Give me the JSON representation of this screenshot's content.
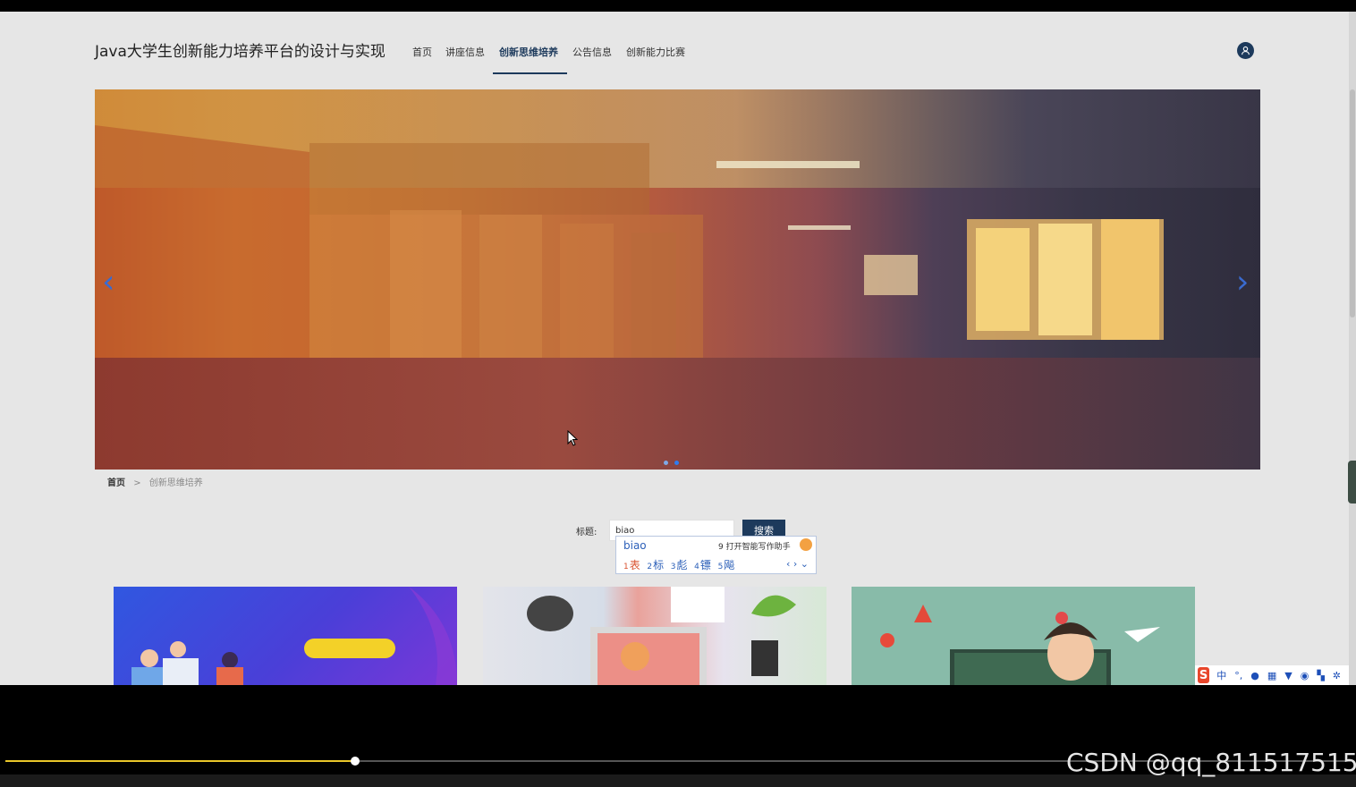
{
  "site": {
    "title": "Java大学生创新能力培养平台的设计与实现"
  },
  "nav": {
    "items": [
      {
        "label": "首页"
      },
      {
        "label": "讲座信息"
      },
      {
        "label": "创新思维培养",
        "active": true
      },
      {
        "label": "公告信息"
      },
      {
        "label": "创新能力比赛"
      }
    ]
  },
  "breadcrumb": {
    "home": "首页",
    "separator": ">",
    "current": "创新思维培养"
  },
  "search": {
    "label": "标题:",
    "value": "biao",
    "button": "搜索"
  },
  "ime": {
    "pinyin": "biao",
    "assist": "9 打开智能写作助手",
    "candidates": [
      {
        "num": "1",
        "text": "表"
      },
      {
        "num": "2",
        "text": "标"
      },
      {
        "num": "3",
        "text": "彪"
      },
      {
        "num": "4",
        "text": "镖"
      },
      {
        "num": "5",
        "text": "飚"
      }
    ],
    "toolbar_lang": "中"
  },
  "player": {
    "progress": 0.26
  },
  "watermark": "CSDN @qq_811517515",
  "colors": {
    "accent": "#1d3a5c",
    "page_bg": "#e6e6e6",
    "progress": "#e9c62a"
  }
}
